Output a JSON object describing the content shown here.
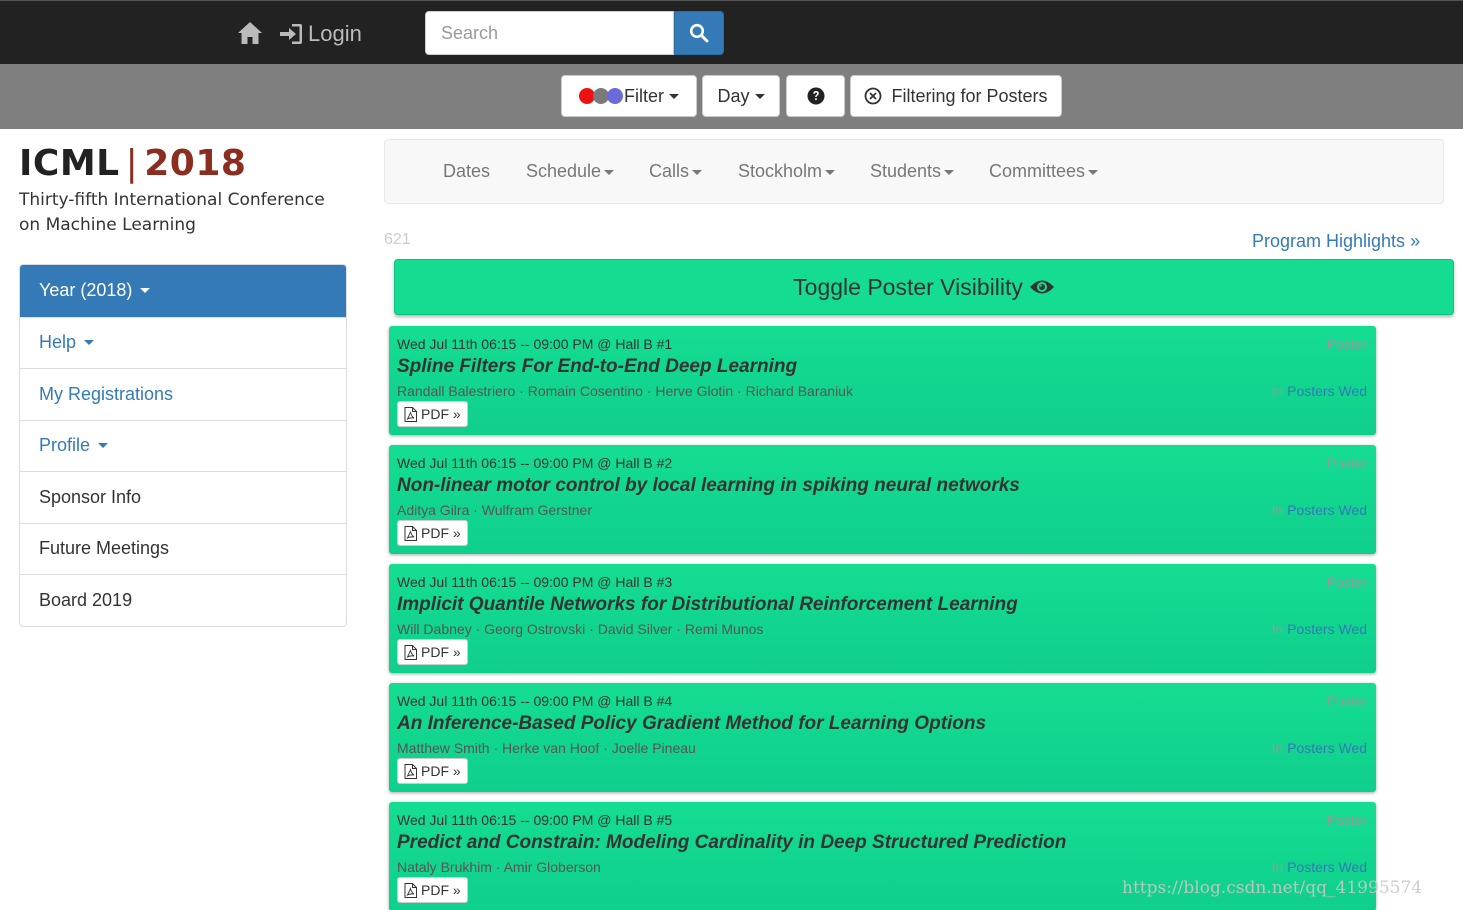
{
  "topbar": {
    "home_icon": "home-icon",
    "login_label": "Login",
    "search_placeholder": "Search",
    "search_icon": "search-icon"
  },
  "filterbar": {
    "filter_label": "Filter",
    "filter_dot_colors": [
      "#ee1111",
      "#7a7a7a",
      "#6a6ad8"
    ],
    "day_label": "Day",
    "help_icon": "question-circle-icon",
    "filtering_label": "Filtering for Posters",
    "filtering_icon": "times-circle-icon"
  },
  "brand": {
    "name": "ICML",
    "separator": "|",
    "year": "2018",
    "subtitle": "Thirty-fifth International Conference on Machine Learning"
  },
  "sidebar": {
    "items": [
      {
        "label": "Year (2018)",
        "state": "active",
        "dropdown": true
      },
      {
        "label": "Help",
        "state": "link",
        "dropdown": true
      },
      {
        "label": "My Registrations",
        "state": "link",
        "dropdown": false
      },
      {
        "label": "Profile",
        "state": "link",
        "dropdown": true
      },
      {
        "label": "Sponsor Info",
        "state": "plain",
        "dropdown": false
      },
      {
        "label": "Future Meetings",
        "state": "plain",
        "dropdown": false
      },
      {
        "label": "Board 2019",
        "state": "plain",
        "dropdown": false
      }
    ]
  },
  "mainnav": {
    "items": [
      {
        "label": "Dates",
        "dropdown": false
      },
      {
        "label": "Schedule",
        "dropdown": true
      },
      {
        "label": "Calls",
        "dropdown": true
      },
      {
        "label": "Stockholm",
        "dropdown": true
      },
      {
        "label": "Students",
        "dropdown": true
      },
      {
        "label": "Committees",
        "dropdown": true
      }
    ]
  },
  "main": {
    "count": "621",
    "highlights_label": "Program Highlights »",
    "toggle_label": "Toggle Poster Visibility",
    "toggle_icon": "eye-icon"
  },
  "posters": [
    {
      "time": "Wed Jul 11th 06:15 -- 09:00 PM @ Hall B #1",
      "type": "Poster",
      "title": "Spline Filters For End-to-End Deep Learning",
      "authors": "Randall Balestriero · Romain Cosentino · Herve Glotin · Richard Baraniuk",
      "in_prefix": "In",
      "in_session": "Posters Wed",
      "pdf_label": "PDF »"
    },
    {
      "time": "Wed Jul 11th 06:15 -- 09:00 PM @ Hall B #2",
      "type": "Poster",
      "title": "Non-linear motor control by local learning in spiking neural networks",
      "authors": "Aditya Gilra · Wulfram Gerstner",
      "in_prefix": "In",
      "in_session": "Posters Wed",
      "pdf_label": "PDF »"
    },
    {
      "time": "Wed Jul 11th 06:15 -- 09:00 PM @ Hall B #3",
      "type": "Poster",
      "title": "Implicit Quantile Networks for Distributional Reinforcement Learning",
      "authors": "Will Dabney · Georg Ostrovski · David Silver · Remi Munos",
      "in_prefix": "In",
      "in_session": "Posters Wed",
      "pdf_label": "PDF »"
    },
    {
      "time": "Wed Jul 11th 06:15 -- 09:00 PM @ Hall B #4",
      "type": "Poster",
      "title": "An Inference-Based Policy Gradient Method for Learning Options",
      "authors": "Matthew Smith · Herke van Hoof · Joelle Pineau",
      "in_prefix": "In",
      "in_session": "Posters Wed",
      "pdf_label": "PDF »"
    },
    {
      "time": "Wed Jul 11th 06:15 -- 09:00 PM @ Hall B #5",
      "type": "Poster",
      "title": "Predict and Constrain: Modeling Cardinality in Deep Structured Prediction",
      "authors": "Nataly Brukhim · Amir Globerson",
      "in_prefix": "In",
      "in_session": "Posters Wed",
      "pdf_label": "PDF »"
    }
  ],
  "watermark": "https://blog.csdn.net/qq_41995574"
}
